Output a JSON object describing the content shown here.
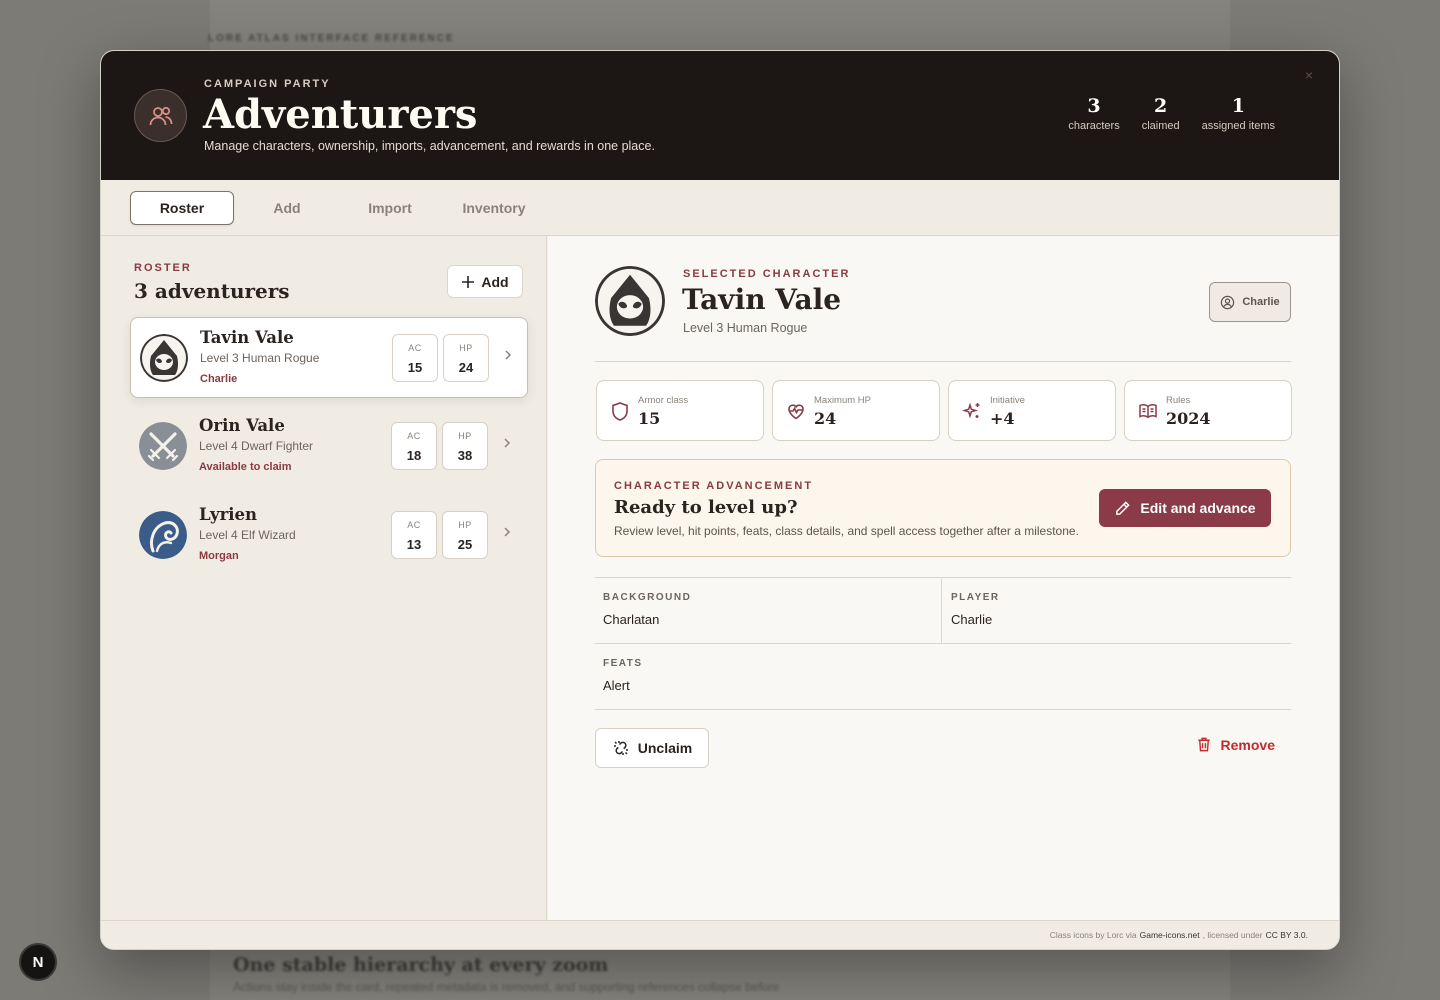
{
  "background": {
    "top_label": "LORE ATLAS INTERFACE REFERENCE",
    "heading": "One stable hierarchy at every zoom",
    "subheading": "Actions stay inside the card, repeated metadata is removed, and supporting references collapse before"
  },
  "next_badge": "N",
  "header": {
    "eyebrow": "CAMPAIGN PARTY",
    "title": "Adventurers",
    "subtitle": "Manage characters, ownership, imports, advancement, and rewards in one place.",
    "close_glyph": "×",
    "stats": [
      {
        "value": "3",
        "label": "characters"
      },
      {
        "value": "2",
        "label": "claimed"
      },
      {
        "value": "1",
        "label": "assigned items"
      }
    ]
  },
  "tabs": [
    {
      "label": "Roster",
      "active": true
    },
    {
      "label": "Add",
      "active": false
    },
    {
      "label": "Import",
      "active": false
    },
    {
      "label": "Inventory",
      "active": false
    }
  ],
  "roster": {
    "eyebrow": "ROSTER",
    "count_label": "3 adventurers",
    "add_label": "Add",
    "stat_labels": {
      "ac": "AC",
      "hp": "HP"
    },
    "characters": [
      {
        "name": "Tavin Vale",
        "desc": "Level 3 Human Rogue",
        "owner": "Charlie",
        "ac": "15",
        "hp": "24",
        "icon": "hooded-rogue-icon",
        "selected": true
      },
      {
        "name": "Orin Vale",
        "desc": "Level 4 Dwarf Fighter",
        "owner": "Available to claim",
        "ac": "18",
        "hp": "38",
        "icon": "crossed-swords-icon",
        "selected": false
      },
      {
        "name": "Lyrien",
        "desc": "Level 4 Elf Wizard",
        "owner": "Morgan",
        "ac": "13",
        "hp": "25",
        "icon": "arcane-swirl-icon",
        "selected": false
      }
    ]
  },
  "selected": {
    "eyebrow": "SELECTED CHARACTER",
    "name": "Tavin Vale",
    "desc": "Level 3 Human Rogue",
    "owner_chip": "Charlie",
    "stats": [
      {
        "label": "Armor class",
        "value": "15",
        "icon": "shield-icon"
      },
      {
        "label": "Maximum HP",
        "value": "24",
        "icon": "heart-pulse-icon"
      },
      {
        "label": "Initiative",
        "value": "+4",
        "icon": "sparkles-icon"
      },
      {
        "label": "Rules",
        "value": "2024",
        "icon": "book-icon"
      }
    ],
    "advancement": {
      "eyebrow": "CHARACTER ADVANCEMENT",
      "title": "Ready to level up?",
      "desc": "Review level, hit points, feats, class details, and spell access together after a milestone.",
      "button": "Edit and advance"
    },
    "fields": {
      "background": {
        "label": "BACKGROUND",
        "value": "Charlatan"
      },
      "player": {
        "label": "PLAYER",
        "value": "Charlie"
      },
      "feats": {
        "label": "FEATS",
        "value": "Alert"
      }
    },
    "unclaim_label": "Unclaim",
    "remove_label": "Remove"
  },
  "footer": {
    "prefix": "Class icons by Lorc via",
    "site": "Game-icons.net",
    "middle": ", licensed under",
    "license": "CC BY 3.0."
  },
  "colors": {
    "accent": "#8b3a48",
    "header_bg": "#1c1714",
    "danger": "#c22b2b"
  }
}
